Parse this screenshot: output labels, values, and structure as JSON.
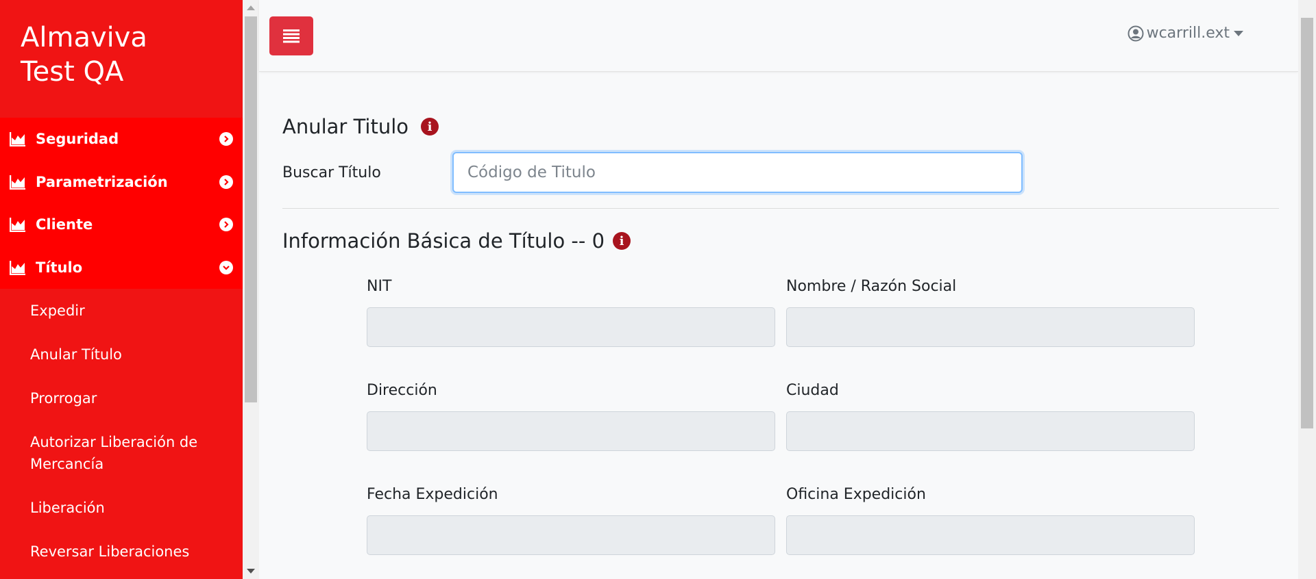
{
  "sidebar": {
    "brand_line1": "Almaviva",
    "brand_line2": "Test QA",
    "brand_color": "#f01414",
    "menu": [
      {
        "label": "Seguridad",
        "icon": "chart-area-icon",
        "state": "collapsed"
      },
      {
        "label": "Parametrización",
        "icon": "chart-area-icon",
        "state": "collapsed"
      },
      {
        "label": "Cliente",
        "icon": "chart-area-icon",
        "state": "collapsed"
      },
      {
        "label": "Título",
        "icon": "chart-area-icon",
        "state": "expanded"
      }
    ],
    "submenu": [
      {
        "label": "Expedir"
      },
      {
        "label": "Anular Título"
      },
      {
        "label": "Prorrogar"
      },
      {
        "label": "Autorizar Liberación de Mercancía"
      },
      {
        "label": "Liberación"
      },
      {
        "label": "Reversar Liberaciones"
      }
    ]
  },
  "topbar": {
    "toggle_icon": "bars-icon",
    "username": "wcarrill.ext",
    "accent_color": "#e0313e"
  },
  "main": {
    "title": "Anular Titulo",
    "search_label": "Buscar Título",
    "search_placeholder": "Código de Titulo",
    "search_value": "",
    "info_title": "Información Básica de Título -- 0",
    "fields": [
      {
        "label": "NIT",
        "value": ""
      },
      {
        "label": "Nombre / Razón Social",
        "value": ""
      },
      {
        "label": "Dirección",
        "value": ""
      },
      {
        "label": "Ciudad",
        "value": ""
      },
      {
        "label": "Fecha Expedición",
        "value": ""
      },
      {
        "label": "Oficina Expedición",
        "value": ""
      }
    ]
  }
}
